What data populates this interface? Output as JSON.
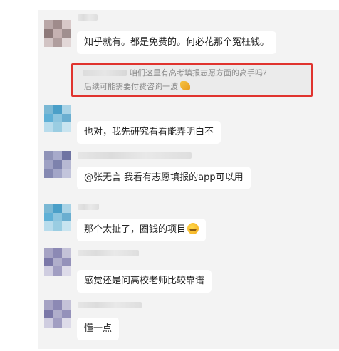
{
  "messages": [
    {
      "text": "知乎就有。都是免费的。何必花那个冤枉钱。",
      "quote": {
        "line1": "咱们这里有高考填报志愿方面的高手吗?",
        "line2": "后续可能需要付费咨询一波",
        "emoji": "raised-hands-emoji"
      }
    },
    {
      "text": "也对，我先研究看看能弄明白不"
    },
    {
      "text": "@张无言 我看有志愿填报的app可以用"
    },
    {
      "text": "那个太扯了，圈钱的项目",
      "emoji": "crying-laughing-emoji"
    },
    {
      "text": "感觉还是问高校老师比较靠谱"
    },
    {
      "text": "懂一点"
    }
  ],
  "colors": {
    "background": "#f3f3f3",
    "bubble": "#ffffff",
    "highlight_border": "#e0332e"
  }
}
